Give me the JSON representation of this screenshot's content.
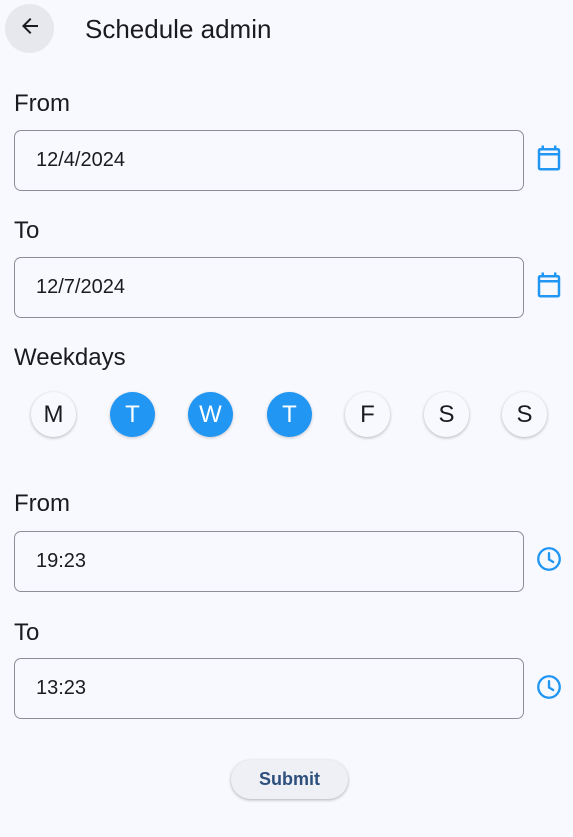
{
  "header": {
    "title": "Schedule admin",
    "back_icon": "arrow-back-icon"
  },
  "date_range": {
    "from_label": "From",
    "from_value": "12/4/2024",
    "to_label": "To",
    "to_value": "12/7/2024",
    "picker_icon": "calendar-icon"
  },
  "weekdays": {
    "label": "Weekdays",
    "days": [
      {
        "letter": "M",
        "selected": false
      },
      {
        "letter": "T",
        "selected": true
      },
      {
        "letter": "W",
        "selected": true
      },
      {
        "letter": "T",
        "selected": true
      },
      {
        "letter": "F",
        "selected": false
      },
      {
        "letter": "S",
        "selected": false
      },
      {
        "letter": "S",
        "selected": false
      }
    ]
  },
  "time_range": {
    "from_label": "From",
    "from_value": "19:23",
    "to_label": "To",
    "to_value": "13:23",
    "picker_icon": "clock-icon"
  },
  "actions": {
    "submit_label": "Submit"
  },
  "colors": {
    "accent": "#2196f3",
    "background": "#f8f9fe",
    "submit_text": "#2d4f7c"
  }
}
